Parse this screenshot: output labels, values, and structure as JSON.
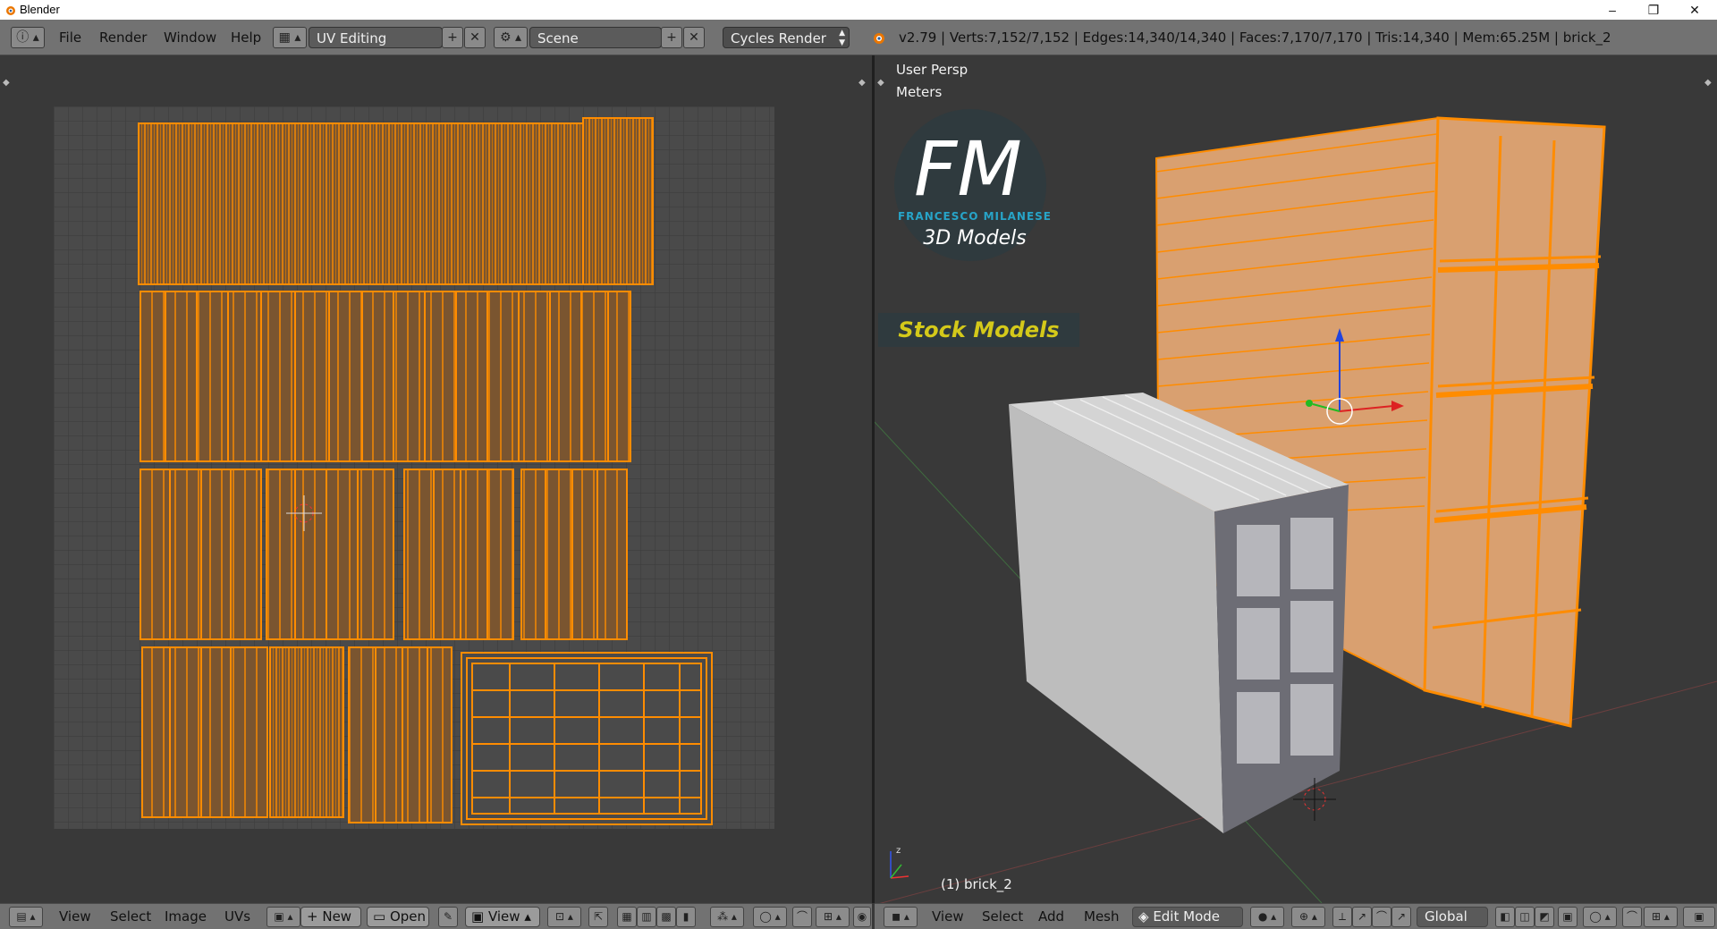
{
  "window": {
    "title": "Blender",
    "controls": [
      "–",
      "❐",
      "✕"
    ]
  },
  "topbar": {
    "menus": [
      "File",
      "Render",
      "Window",
      "Help"
    ],
    "screen_layout": "UV Editing",
    "scene": "Scene",
    "render_engine": "Cycles Render",
    "stats": "v2.79 | Verts:7,152/7,152 | Edges:14,340/14,340 | Faces:7,170/7,170 | Tris:14,340 | Mem:65.25M | brick_2"
  },
  "viewport": {
    "view_name": "User Persp",
    "units": "Meters",
    "object_label": "(1) brick_2",
    "logo": {
      "letters": "FM",
      "name": "FRANCESCO MILANESE",
      "tagline": "3D Models",
      "banner": "Stock Models"
    }
  },
  "uv_footer": {
    "menus": [
      "View",
      "Select",
      "Image",
      "UVs"
    ],
    "new_label": "New",
    "open_label": "Open",
    "view_label": "View"
  },
  "view3d_footer": {
    "menus": [
      "View",
      "Select",
      "Add",
      "Mesh"
    ],
    "mode": "Edit Mode",
    "orientation": "Global"
  },
  "colors": {
    "header": "#727272",
    "background": "#393939",
    "uv_face": "#7a5530",
    "uv_edge": "#ff8c00",
    "brick": "#c2c2c2"
  }
}
